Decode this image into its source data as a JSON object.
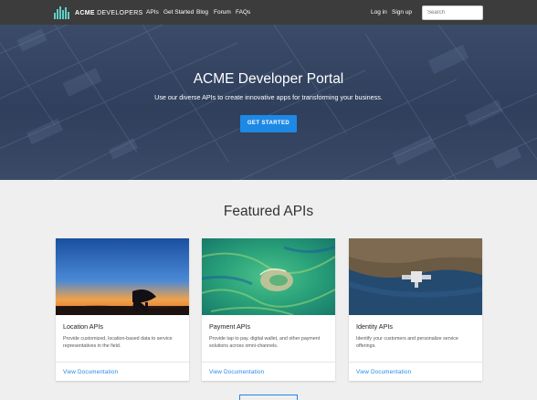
{
  "header": {
    "logo_brand": "ACME",
    "logo_suffix": "DEVELOPERS",
    "nav": [
      {
        "label": "APIs"
      },
      {
        "label": "Get Started"
      },
      {
        "label": "Blog"
      },
      {
        "label": "Forum"
      },
      {
        "label": "FAQs"
      }
    ],
    "login_label": "Log in",
    "signup_label": "Sign up",
    "search_placeholder": "Search"
  },
  "hero": {
    "title": "ACME Developer Portal",
    "subtitle": "Use our diverse APIs to create innovative apps for transforming your business.",
    "cta_label": "GET STARTED"
  },
  "featured": {
    "title": "Featured APIs",
    "cards": [
      {
        "title": "Location APIs",
        "text": "Provide customized, location-based data to service representatives in the field.",
        "link": "View Documentation",
        "image": "radio-telescope-sunset"
      },
      {
        "title": "Payment APIs",
        "text": "Provide tap to pay, digital wallet, and other payment solutions across omni-channels.",
        "link": "View Documentation",
        "image": "aerial-ocean-island"
      },
      {
        "title": "Identity APIs",
        "text": "Identify your customers and personalize service offerings.",
        "link": "View Documentation",
        "image": "satellite-over-earth"
      }
    ]
  },
  "colors": {
    "navbar": "#3c3c3c",
    "accent": "#1e88e5",
    "logo": "#5fd0c4",
    "page_bg": "#efefef"
  }
}
